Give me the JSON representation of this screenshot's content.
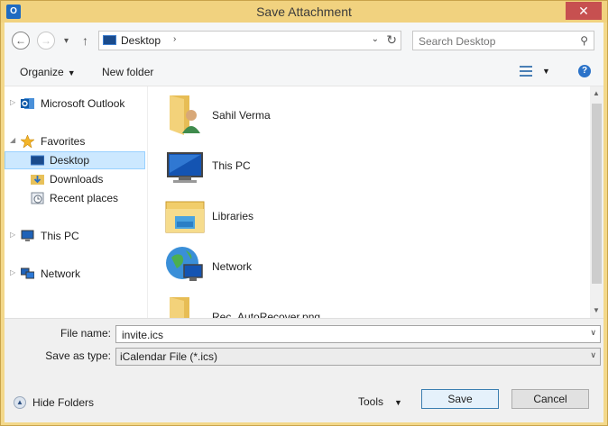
{
  "window": {
    "title": "Save Attachment",
    "app_icon_letter": "O",
    "close_glyph": "✕"
  },
  "nav": {
    "back_glyph": "←",
    "forward_glyph": "→",
    "recent_glyph": "▾",
    "up_glyph": "↑",
    "address": "Desktop",
    "address_chevron": "›",
    "address_dropdown": "⌄",
    "refresh_glyph": "↻",
    "search_placeholder": "Search Desktop",
    "search_glyph": "⚲"
  },
  "toolbar": {
    "organize_label": "Organize",
    "organize_caret": "▼",
    "new_folder_label": "New folder",
    "view_caret": "▼",
    "help_glyph": "?"
  },
  "tree": {
    "items": [
      {
        "label": "Microsoft Outlook",
        "icon": "outlook-icon",
        "expander": "▷"
      },
      {
        "label": "Favorites",
        "icon": "star-icon",
        "expander": "◢"
      },
      {
        "label": "Desktop",
        "icon": "desktop-icon",
        "selected": true
      },
      {
        "label": "Downloads",
        "icon": "downloads-folder-icon"
      },
      {
        "label": "Recent places",
        "icon": "recent-places-icon"
      },
      {
        "label": "This PC",
        "icon": "computer-icon",
        "expander": "▷"
      },
      {
        "label": "Network",
        "icon": "network-icon",
        "expander": "▷"
      }
    ]
  },
  "files": [
    {
      "label": "Sahil Verma",
      "icon": "user-folder-icon"
    },
    {
      "label": "This PC",
      "icon": "computer-icon"
    },
    {
      "label": "Libraries",
      "icon": "libraries-icon"
    },
    {
      "label": "Network",
      "icon": "network-globe-icon"
    },
    {
      "label": "Rec_AutoRecover.png",
      "icon": "folder-icon"
    }
  ],
  "scroll": {
    "up_glyph": "▲",
    "down_glyph": "▼"
  },
  "form": {
    "file_name_label": "File name:",
    "file_name_value": "invite.ics",
    "save_type_label": "Save as type:",
    "save_type_value": "iCalendar File (*.ics)",
    "dropdown_glyph": "∨"
  },
  "footer": {
    "hide_folders_label": "Hide Folders",
    "hide_folders_glyph": "▲",
    "tools_label": "Tools",
    "tools_caret": "▼",
    "save_label": "Save",
    "cancel_label": "Cancel"
  },
  "colors": {
    "title_bar": "#f1d27f",
    "selection": "#cce8ff",
    "accent": "#3c7fb1"
  }
}
